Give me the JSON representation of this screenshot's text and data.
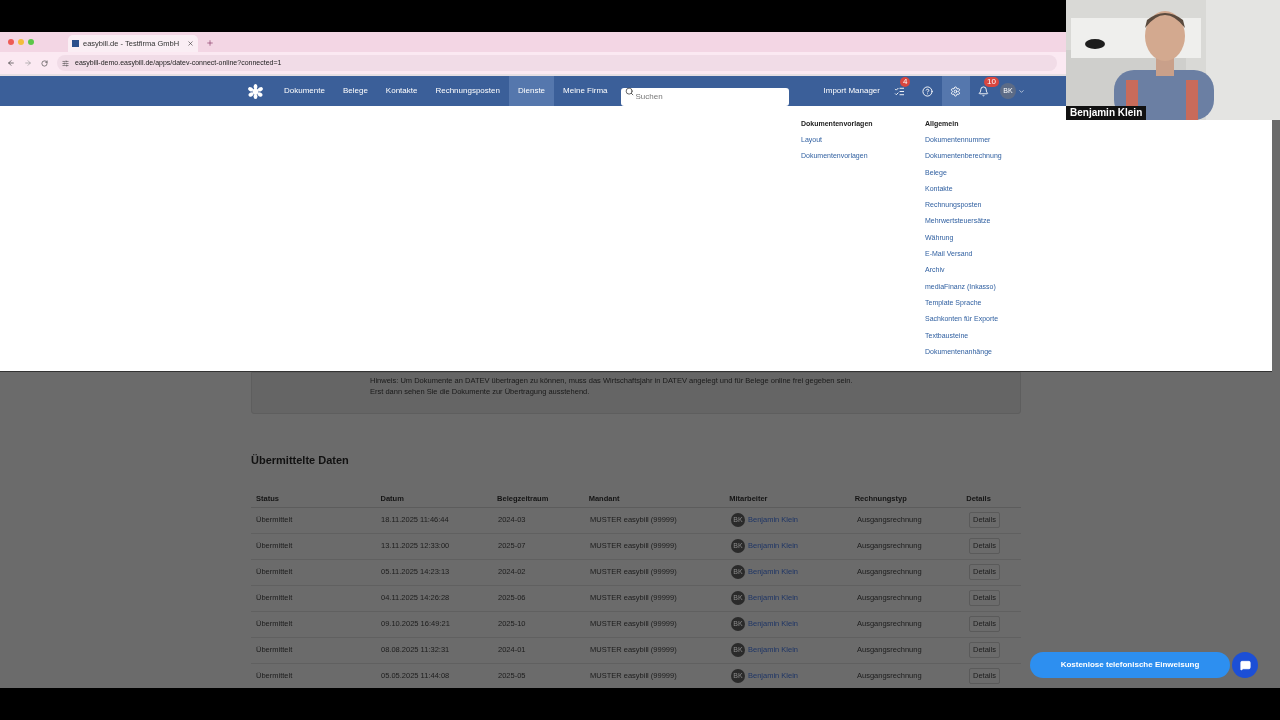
{
  "browser": {
    "tab_title": "easybill.de - Testfirma GmbH",
    "url": "easybill-demo.easybill.de/apps/datev-connect-online?connected=1"
  },
  "nav": {
    "items": [
      {
        "label": "Dokumente",
        "selected": false
      },
      {
        "label": "Belege",
        "selected": false
      },
      {
        "label": "Kontakte",
        "selected": false
      },
      {
        "label": "Rechnungsposten",
        "selected": false
      },
      {
        "label": "Dienste",
        "selected": true
      },
      {
        "label": "Meine Firma",
        "selected": false
      }
    ],
    "search": {
      "placeholder": "Suchen"
    },
    "import_manager": "Import Manager",
    "icon_buttons": [
      {
        "kind": "tasks",
        "badge": "4",
        "selected": false
      },
      {
        "kind": "help",
        "selected": false
      },
      {
        "kind": "settings",
        "selected": true
      },
      {
        "kind": "notifications",
        "badge": "10",
        "selected": false
      }
    ],
    "avatar": "BK"
  },
  "menu": {
    "columns": [
      {
        "heading": "Dokumentenvorlagen",
        "items": [
          "Layout",
          "Dokumentenvorlagen"
        ]
      },
      {
        "heading": "Allgemein",
        "items": [
          "Dokumentennummer",
          "Dokumentenberechnung",
          "Belege",
          "Kontakte",
          "Rechnungsposten",
          "Mehrwertsteuersätze",
          "Währung",
          "E-Mail Versand",
          "Archiv",
          "mediaFinanz (Inkasso)",
          "Template Sprache",
          "Sachkonten für Exporte",
          "Textbausteine",
          "Dokumentenanhänge"
        ]
      }
    ]
  },
  "hint": [
    "Hinweis: Um Dokumente an DATEV übertragen zu können, muss das Wirtschaftsjahr in DATEV angelegt und für Belege online frei gegeben sein.",
    "Erst dann sehen Sie die Dokumente zur Übertragung ausstehend."
  ],
  "section_title": "Übermittelte Daten",
  "table": {
    "columns": [
      "Status",
      "Datum",
      "Belegzeitraum",
      "Mandant",
      "Mitarbeiter",
      "Rechnungstyp",
      "Details"
    ],
    "rows": [
      {
        "status": "Übermittelt",
        "datum": "18.11.2025 11:46:44",
        "zeitraum": "2024-03",
        "mandant": "MUSTER easybill (99999)",
        "avatar": "BK",
        "mitarbeiter": "Benjamin Klein",
        "typ": "Ausgangsrechnung",
        "details": "Details"
      },
      {
        "status": "Übermittelt",
        "datum": "13.11.2025 12:33:00",
        "zeitraum": "2025-07",
        "mandant": "MUSTER easybill (99999)",
        "avatar": "BK",
        "mitarbeiter": "Benjamin Klein",
        "typ": "Ausgangsrechnung",
        "details": "Details"
      },
      {
        "status": "Übermittelt",
        "datum": "05.11.2025 14:23:13",
        "zeitraum": "2024-02",
        "mandant": "MUSTER easybill (99999)",
        "avatar": "BK",
        "mitarbeiter": "Benjamin Klein",
        "typ": "Ausgangsrechnung",
        "details": "Details"
      },
      {
        "status": "Übermittelt",
        "datum": "04.11.2025 14:26:28",
        "zeitraum": "2025-06",
        "mandant": "MUSTER easybill (99999)",
        "avatar": "BK",
        "mitarbeiter": "Benjamin Klein",
        "typ": "Ausgangsrechnung",
        "details": "Details"
      },
      {
        "status": "Übermittelt",
        "datum": "09.10.2025 16:49:21",
        "zeitraum": "2025-10",
        "mandant": "MUSTER easybill (99999)",
        "avatar": "BK",
        "mitarbeiter": "Benjamin Klein",
        "typ": "Ausgangsrechnung",
        "details": "Details"
      },
      {
        "status": "Übermittelt",
        "datum": "08.08.2025 11:32:31",
        "zeitraum": "2024-01",
        "mandant": "MUSTER easybill (99999)",
        "avatar": "BK",
        "mitarbeiter": "Benjamin Klein",
        "typ": "Ausgangsrechnung",
        "details": "Details"
      },
      {
        "status": "Übermittelt",
        "datum": "05.05.2025 11:44:08",
        "zeitraum": "2025-05",
        "mandant": "MUSTER easybill (99999)",
        "avatar": "BK",
        "mitarbeiter": "Benjamin Klein",
        "typ": "Ausgangsrechnung",
        "details": "Details"
      }
    ]
  },
  "chat_button": "Kostenlose telefonische Einweisung",
  "video": {
    "name": "Benjamin Klein"
  }
}
